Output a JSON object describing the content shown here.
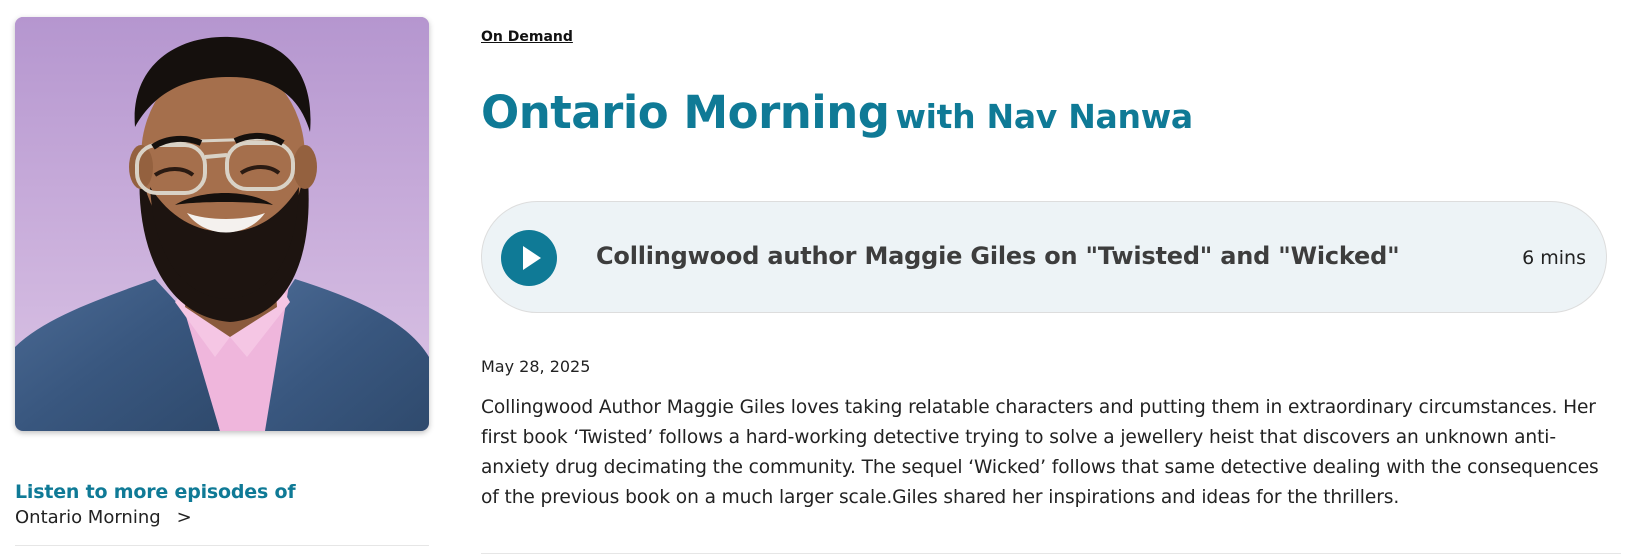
{
  "breadcrumb": {
    "label": "On Demand"
  },
  "show": {
    "title": "Ontario Morning",
    "host_suffix": "with Nav Nanwa"
  },
  "player": {
    "episode_title": "Collingwood author Maggie Giles on \"Twisted\" and \"Wicked\"",
    "duration": "6 mins",
    "play_icon": "play-icon"
  },
  "episode": {
    "date": "May 28, 2025",
    "description": "Collingwood Author Maggie Giles loves taking relatable characters and putting them in extraordinary circumstances. Her first book ‘Twisted’ follows a hard-working detective trying to solve a jewellery heist that discovers an unknown anti-anxiety drug decimating the community. The sequel ‘Wicked’ follows that same detective dealing with the consequences of the previous book on a much larger scale.Giles shared her inspirations and ideas for the thrillers."
  },
  "sidebar": {
    "more_heading": "Listen to more episodes of",
    "show_link": "Ontario Morning",
    "chevron": ">"
  },
  "colors": {
    "accent": "#0f7a96",
    "player_bg": "#edf3f6",
    "text": "#222222"
  }
}
